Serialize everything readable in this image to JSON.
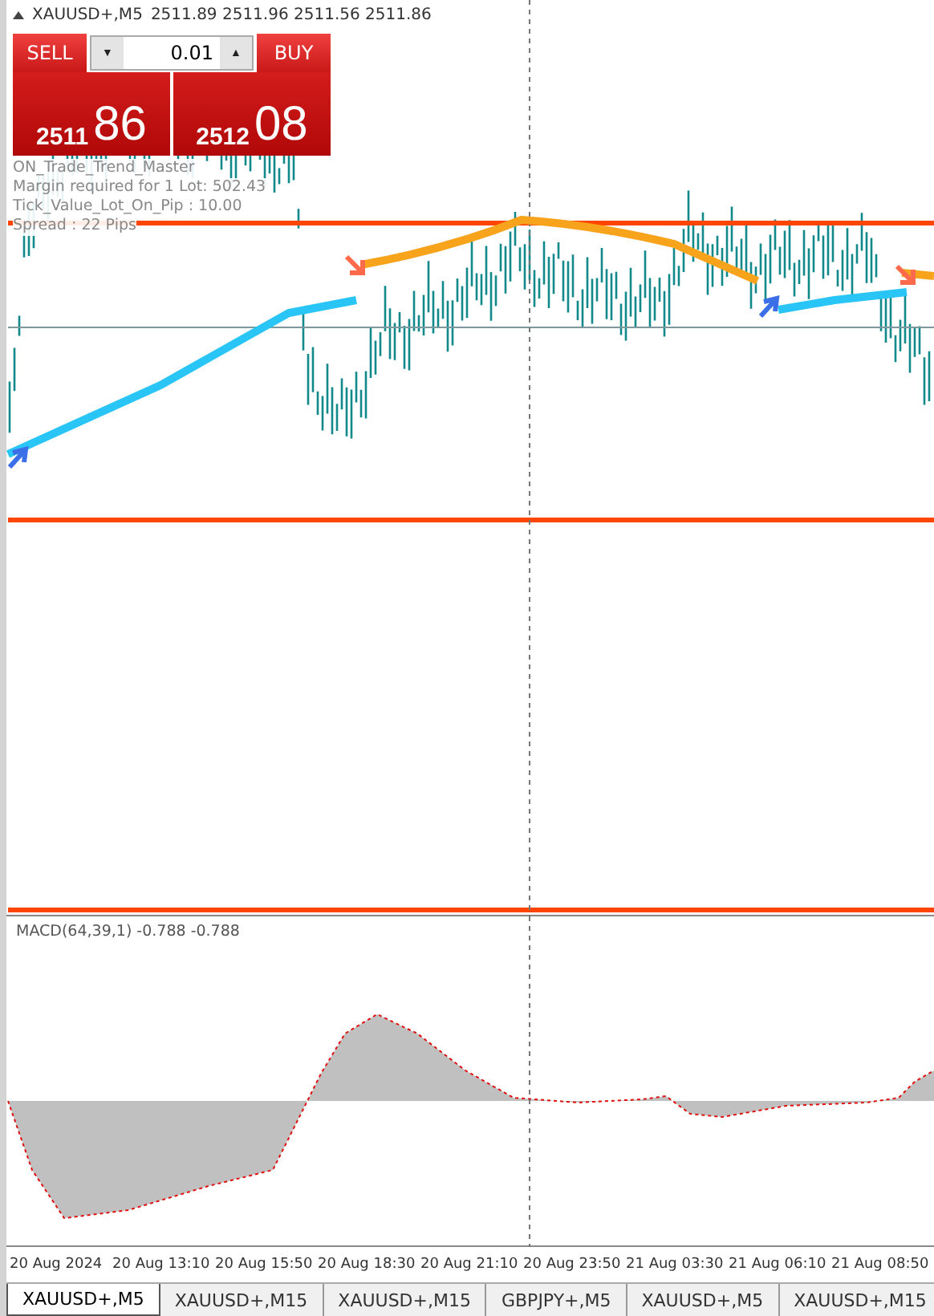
{
  "chart_header": {
    "title": "XAUUSD+,M5",
    "quotes": "2511.89 2511.96 2511.56 2511.86"
  },
  "trade_panel": {
    "sell_label": "SELL",
    "buy_label": "BUY",
    "volume": "0.01",
    "down_arrow": "▼",
    "up_arrow": "▲",
    "bid_big": "2511",
    "bid_small": "86",
    "ask_big": "2512",
    "ask_small": "08"
  },
  "info_lines": [
    "ON_Trade_Trend_Master",
    "Margin required for 1 Lot: 502.43",
    "Tick_Value_Lot_On_Pip : 10.00",
    "Spread : 22 Pips"
  ],
  "indicator": {
    "label": "MACD(64,39,1) -0.788 -0.788"
  },
  "time_axis": [
    "20 Aug 2024",
    "20 Aug 13:10",
    "20 Aug 15:50",
    "20 Aug 18:30",
    "20 Aug 21:10",
    "20 Aug 23:50",
    "21 Aug 03:30",
    "21 Aug 06:10",
    "21 Aug 08:50"
  ],
  "tabs": [
    {
      "label": "XAUUSD+,M5",
      "selected": true
    },
    {
      "label": "XAUUSD+,M15",
      "selected": false
    },
    {
      "label": "XAUUSD+,M15",
      "selected": false
    },
    {
      "label": "GBPJPY+,M5",
      "selected": false
    },
    {
      "label": "XAUUSD+,M5",
      "selected": false
    },
    {
      "label": "XAUUSD+,M15",
      "selected": false
    }
  ]
}
